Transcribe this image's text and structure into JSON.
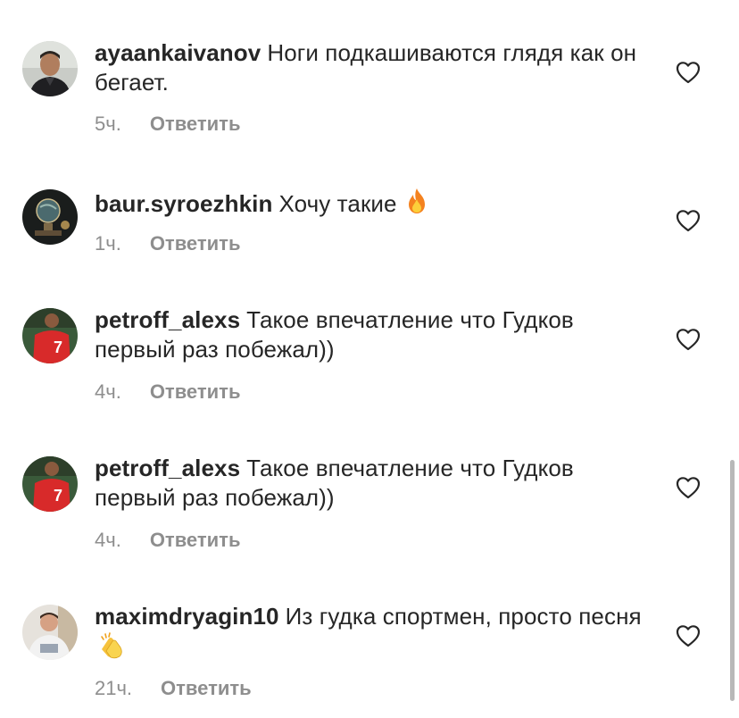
{
  "comments": [
    {
      "username": "ayaankaivanov",
      "text": "Ноги подкашиваются глядя как он бегает.",
      "time": "5ч.",
      "reply_label": "Ответить",
      "emoji": "",
      "avatar": "man-portrait-avatar"
    },
    {
      "username": "baur.syroezhkin",
      "text": "Хочу такие",
      "time": "1ч.",
      "reply_label": "Ответить",
      "emoji": "fire-emoji",
      "avatar": "globe-lamp-avatar"
    },
    {
      "username": "petroff_alexs",
      "text": "Такое впечатление что Гудков первый раз побежал))",
      "time": "4ч.",
      "reply_label": "Ответить",
      "emoji": "",
      "avatar": "footballer-red-jersey-avatar"
    },
    {
      "username": "petroff_alexs",
      "text": "Такое впечатление что Гудков первый раз побежал))",
      "time": "4ч.",
      "reply_label": "Ответить",
      "emoji": "",
      "avatar": "footballer-red-jersey-avatar"
    },
    {
      "username": "maximdryagin10",
      "text": "Из гудка спортмен, просто песня",
      "time": "21ч.",
      "reply_label": "Ответить",
      "emoji": "clapping-hands-emoji",
      "avatar": "man-white-shirt-avatar"
    }
  ],
  "icons": {
    "like": "heart-outline-icon"
  },
  "colors": {
    "text": "#262626",
    "secondary": "#8e8e8e",
    "background": "#ffffff"
  }
}
